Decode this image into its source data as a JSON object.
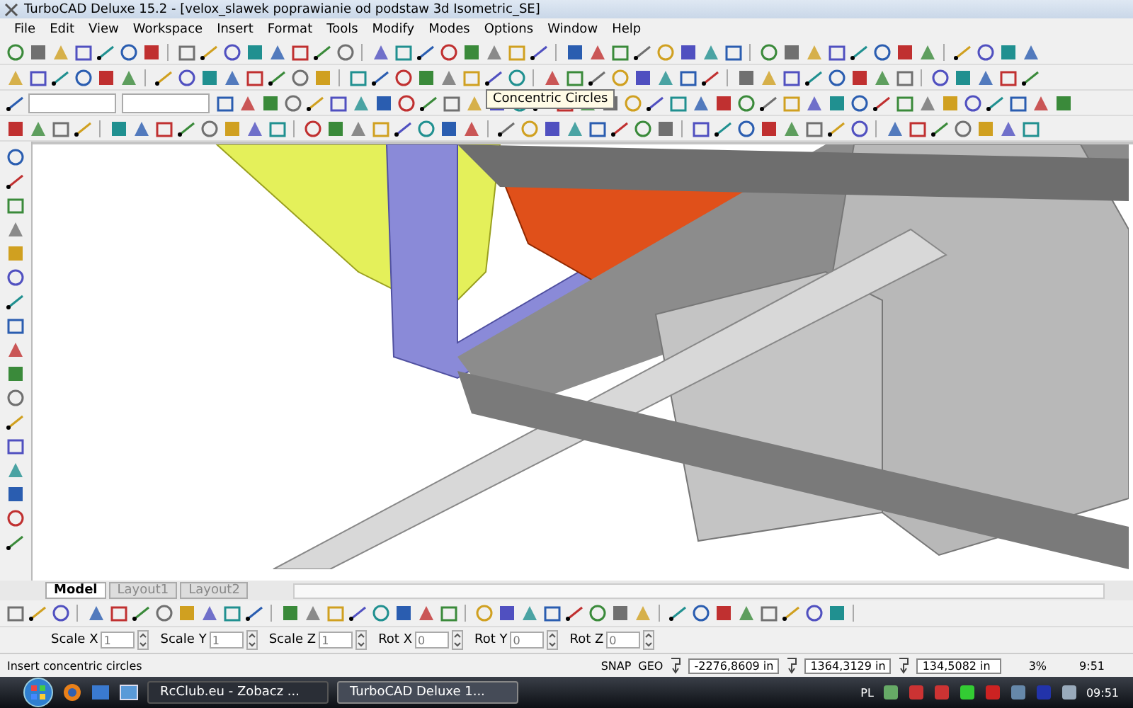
{
  "window": {
    "title": "TurboCAD Deluxe 15.2 - [velox_slawek poprawianie od podstaw 3d Isometric_SE]"
  },
  "menu": [
    "File",
    "Edit",
    "View",
    "Workspace",
    "Insert",
    "Format",
    "Tools",
    "Modify",
    "Modes",
    "Options",
    "Window",
    "Help"
  ],
  "tooltip": "Concentric Circles",
  "tabs": [
    {
      "label": "Model",
      "selected": true
    },
    {
      "label": "Layout1",
      "selected": false
    },
    {
      "label": "Layout2",
      "selected": false
    }
  ],
  "transform_fields": [
    {
      "label": "Scale X",
      "value": "1"
    },
    {
      "label": "Scale Y",
      "value": "1"
    },
    {
      "label": "Scale Z",
      "value": "1"
    },
    {
      "label": "Rot X",
      "value": "0"
    },
    {
      "label": "Rot Y",
      "value": "0"
    },
    {
      "label": "Rot Z",
      "value": "0"
    }
  ],
  "status_bar": {
    "message": "Insert concentric circles",
    "snap": "SNAP",
    "geo": "GEO",
    "coordinates": [
      "-2276,8609 in",
      "1364,3129 in",
      "134,5082 in"
    ],
    "zoom": "3%",
    "time": "9:51"
  },
  "taskbar": {
    "tasks": [
      {
        "label": "RcClub.eu - Zobacz ...",
        "selected": false
      },
      {
        "label": "TurboCAD Deluxe 1...",
        "selected": true
      }
    ],
    "language": "PL",
    "clock": "09:51"
  }
}
